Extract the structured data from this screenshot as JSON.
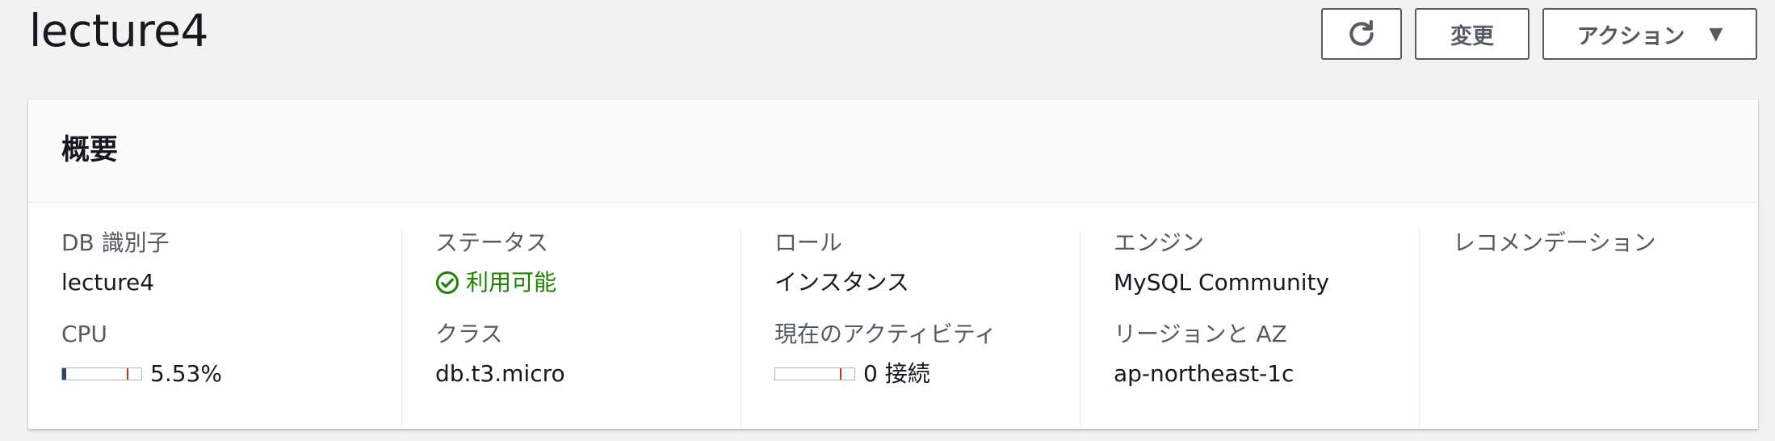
{
  "header": {
    "title": "lecture4",
    "refresh_icon": "refresh-icon",
    "modify_label": "変更",
    "actions_label": "アクション",
    "actions_caret_icon": "caret-down-icon"
  },
  "panel": {
    "title": "概要",
    "fields": {
      "db_identifier": {
        "label": "DB 識別子",
        "value": "lecture4"
      },
      "cpu": {
        "label": "CPU",
        "value": "5.53%",
        "fraction": 0.0553
      },
      "status": {
        "label": "ステータス",
        "value": "利用可能",
        "icon": "check-circle-icon",
        "color": "#1d8102"
      },
      "class": {
        "label": "クラス",
        "value": "db.t3.micro"
      },
      "role": {
        "label": "ロール",
        "value": "インスタンス"
      },
      "current_activity": {
        "label": "現在のアクティビティ",
        "value": "0 接続",
        "fraction": 0
      },
      "engine": {
        "label": "エンジン",
        "value": "MySQL Community"
      },
      "region_az": {
        "label": "リージョンと AZ",
        "value": "ap-northeast-1c"
      },
      "recommendations": {
        "label": "レコメンデーション"
      }
    }
  },
  "colors": {
    "background": "#f2f2f2",
    "text": "#16191f",
    "label": "#545b64",
    "success": "#1d8102",
    "bar_fill": "#2e4369",
    "bar_threshold": "#d13212"
  }
}
